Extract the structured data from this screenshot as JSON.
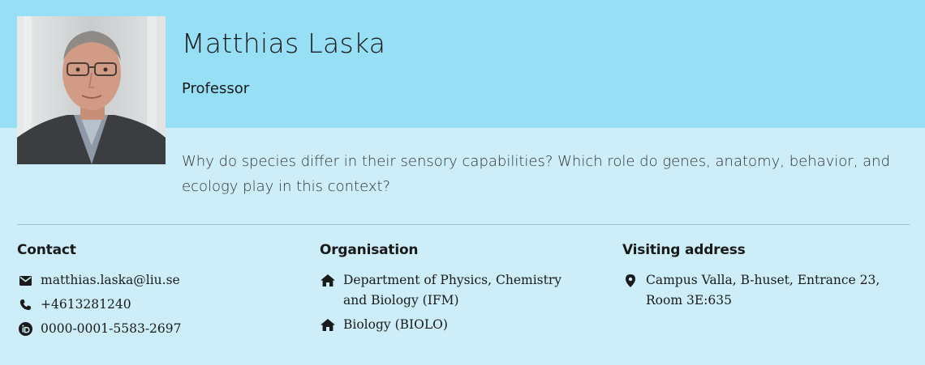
{
  "profile": {
    "name": "Matthias Laska",
    "role": "Professor",
    "intro": "Why do species differ in their sensory capabilities? Which role do genes, anatomy, behavior, and ecology play in this context?"
  },
  "contact": {
    "heading": "Contact",
    "email": "matthias.laska@liu.se",
    "phone": "+4613281240",
    "orcid": "0000-0001-5583-2697"
  },
  "organisation": {
    "heading": "Organisation",
    "items": [
      "Department of Physics, Chemistry and Biology (IFM)",
      "Biology (BIOLO)"
    ]
  },
  "visiting": {
    "heading": "Visiting address",
    "address": "Campus Valla, B-huset, Entrance 23, Room 3E:635"
  },
  "colors": {
    "top_band": "#96dff5",
    "page_bg": "#cdeef8"
  },
  "icons": {
    "email": "envelope-icon",
    "phone": "phone-icon",
    "orcid": "orcid-icon",
    "organisation": "home-icon",
    "address": "map-pin-icon"
  }
}
